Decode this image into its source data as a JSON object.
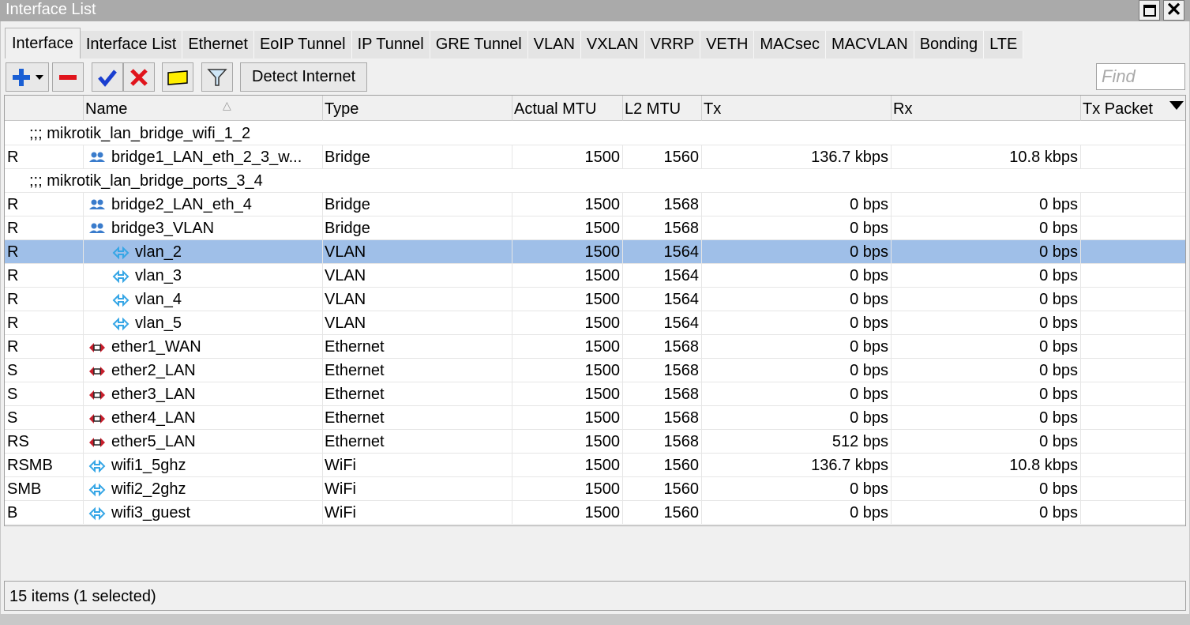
{
  "window": {
    "title": "Interface List"
  },
  "tabs": [
    {
      "label": "Interface",
      "active": true
    },
    {
      "label": "Interface List"
    },
    {
      "label": "Ethernet"
    },
    {
      "label": "EoIP Tunnel"
    },
    {
      "label": "IP Tunnel"
    },
    {
      "label": "GRE Tunnel"
    },
    {
      "label": "VLAN"
    },
    {
      "label": "VXLAN"
    },
    {
      "label": "VRRP"
    },
    {
      "label": "VETH"
    },
    {
      "label": "MACsec"
    },
    {
      "label": "MACVLAN"
    },
    {
      "label": "Bonding"
    },
    {
      "label": "LTE"
    }
  ],
  "toolbar": {
    "detect_label": "Detect Internet",
    "find_placeholder": "Find"
  },
  "colors": {
    "selected_row": "#9fbfe8",
    "add_icon": "#1a5fd4",
    "remove_icon": "#e0141c",
    "enable_icon": "#1a3fd0",
    "disable_icon": "#e0141c",
    "comment_icon": "#ffee00",
    "bridge_icon": "#3a7ccc",
    "vlan_icon": "#36a6e6",
    "ether_icon": "#c81e2c"
  },
  "columns": [
    "Name",
    "Type",
    "Actual MTU",
    "L2 MTU",
    "Tx",
    "Rx",
    "Tx Packet"
  ],
  "rows": [
    {
      "kind": "comment",
      "comment": ";;; mikrotik_lan_bridge_wifi_1_2"
    },
    {
      "flags": "R",
      "name": "bridge1_LAN_eth_2_3_w...",
      "icon": "bridge-icon",
      "level": 0,
      "type": "Bridge",
      "actual_mtu": "1500",
      "l2_mtu": "1560",
      "tx": "136.7 kbps",
      "rx": "10.8 kbps"
    },
    {
      "kind": "comment",
      "comment": ";;; mikrotik_lan_bridge_ports_3_4"
    },
    {
      "flags": "R",
      "name": "bridge2_LAN_eth_4",
      "icon": "bridge-icon",
      "level": 0,
      "type": "Bridge",
      "actual_mtu": "1500",
      "l2_mtu": "1568",
      "tx": "0 bps",
      "rx": "0 bps"
    },
    {
      "flags": "R",
      "name": "bridge3_VLAN",
      "icon": "bridge-icon",
      "level": 0,
      "type": "Bridge",
      "actual_mtu": "1500",
      "l2_mtu": "1568",
      "tx": "0 bps",
      "rx": "0 bps"
    },
    {
      "flags": "R",
      "name": "vlan_2",
      "icon": "vlan-icon",
      "level": 1,
      "type": "VLAN",
      "actual_mtu": "1500",
      "l2_mtu": "1564",
      "tx": "0 bps",
      "rx": "0 bps",
      "selected": true
    },
    {
      "flags": "R",
      "name": "vlan_3",
      "icon": "vlan-icon",
      "level": 1,
      "type": "VLAN",
      "actual_mtu": "1500",
      "l2_mtu": "1564",
      "tx": "0 bps",
      "rx": "0 bps"
    },
    {
      "flags": "R",
      "name": "vlan_4",
      "icon": "vlan-icon",
      "level": 1,
      "type": "VLAN",
      "actual_mtu": "1500",
      "l2_mtu": "1564",
      "tx": "0 bps",
      "rx": "0 bps"
    },
    {
      "flags": "R",
      "name": "vlan_5",
      "icon": "vlan-icon",
      "level": 1,
      "type": "VLAN",
      "actual_mtu": "1500",
      "l2_mtu": "1564",
      "tx": "0 bps",
      "rx": "0 bps"
    },
    {
      "flags": "R",
      "name": "ether1_WAN",
      "icon": "ethernet-icon",
      "level": 0,
      "type": "Ethernet",
      "actual_mtu": "1500",
      "l2_mtu": "1568",
      "tx": "0 bps",
      "rx": "0 bps"
    },
    {
      "flags": "S",
      "name": "ether2_LAN",
      "icon": "ethernet-icon",
      "level": 0,
      "type": "Ethernet",
      "actual_mtu": "1500",
      "l2_mtu": "1568",
      "tx": "0 bps",
      "rx": "0 bps"
    },
    {
      "flags": "S",
      "name": "ether3_LAN",
      "icon": "ethernet-icon",
      "level": 0,
      "type": "Ethernet",
      "actual_mtu": "1500",
      "l2_mtu": "1568",
      "tx": "0 bps",
      "rx": "0 bps"
    },
    {
      "flags": "S",
      "name": "ether4_LAN",
      "icon": "ethernet-icon",
      "level": 0,
      "type": "Ethernet",
      "actual_mtu": "1500",
      "l2_mtu": "1568",
      "tx": "0 bps",
      "rx": "0 bps"
    },
    {
      "flags": "RS",
      "name": "ether5_LAN",
      "icon": "ethernet-icon",
      "level": 0,
      "type": "Ethernet",
      "actual_mtu": "1500",
      "l2_mtu": "1568",
      "tx": "512 bps",
      "rx": "0 bps"
    },
    {
      "flags": "RSMB",
      "name": "wifi1_5ghz",
      "icon": "wifi-icon",
      "level": 0,
      "type": "WiFi",
      "actual_mtu": "1500",
      "l2_mtu": "1560",
      "tx": "136.7 kbps",
      "rx": "10.8 kbps"
    },
    {
      "flags": "SMB",
      "name": "wifi2_2ghz",
      "icon": "wifi-icon",
      "level": 0,
      "type": "WiFi",
      "actual_mtu": "1500",
      "l2_mtu": "1560",
      "tx": "0 bps",
      "rx": "0 bps"
    },
    {
      "flags": "B",
      "name": "wifi3_guest",
      "icon": "wifi-icon",
      "level": 0,
      "type": "WiFi",
      "actual_mtu": "1500",
      "l2_mtu": "1560",
      "tx": "0 bps",
      "rx": "0 bps"
    }
  ],
  "status": {
    "text": "15 items (1 selected)"
  }
}
